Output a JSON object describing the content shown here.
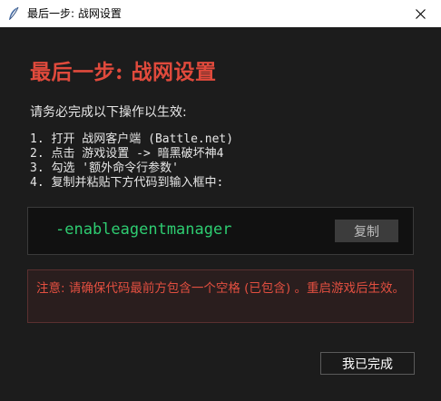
{
  "window": {
    "title": "最后一步: 战网设置",
    "icon": "feather-icon",
    "close_icon": "close-icon"
  },
  "content": {
    "heading": "最后一步: 战网设置",
    "intro": "请务必完成以下操作以生效:",
    "steps": [
      "1. 打开 战网客户端 (Battle.net)",
      "2. 点击 游戏设置 -> 暗黑破坏神4",
      "3. 勾选 '额外命令行参数'",
      "4. 复制并粘贴下方代码到输入框中:"
    ],
    "code": "-enableagentmanager",
    "copy_label": "复制",
    "warning": "注意: 请确保代码最前方包含一个空格 (已包含) 。重启游戏后生效。",
    "done_label": "我已完成"
  },
  "colors": {
    "background": "#1c1c1c",
    "heading": "#e04a3c",
    "code": "#2ecc71",
    "warning_text": "#e24f40",
    "warning_bg": "#2a1e1e"
  }
}
